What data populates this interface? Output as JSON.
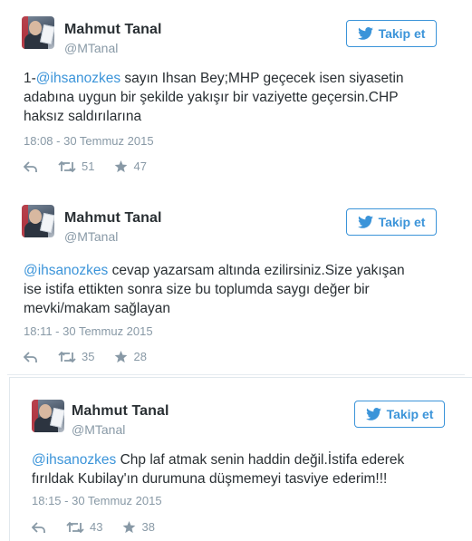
{
  "colors": {
    "accent": "#3b94d9",
    "text": "#292f33",
    "muted": "#8899a6"
  },
  "tweets": [
    {
      "name": "Mahmut Tanal",
      "handle": "@MTanal",
      "follow_label": "Takip et",
      "mention": "@ihsanozkes",
      "lines": [
        " sayın Ihsan Bey;MHP geçecek isen siyasetin",
        "adabına uygun bir şekilde yakışır bir vaziyette geçersin.CHP",
        "haksız saldırılarına"
      ],
      "prefix": "1-",
      "timestamp": "18:08 - 30 Temmuz 2015",
      "retweets": "51",
      "likes": "47"
    },
    {
      "name": "Mahmut Tanal",
      "handle": "@MTanal",
      "follow_label": "Takip et",
      "mention": "@ihsanozkes",
      "lines": [
        " cevap yazarsam altında ezilirsiniz.Size yakışan",
        "ise istifa ettikten sonra size bu toplumda saygı değer bir",
        "mevki/makam sağlayan"
      ],
      "prefix": "",
      "timestamp": "18:11 - 30 Temmuz 2015",
      "retweets": "35",
      "likes": "28"
    },
    {
      "name": "Mahmut Tanal",
      "handle": "@MTanal",
      "follow_label": "Takip et",
      "mention": "@ihsanozkes",
      "lines": [
        " Chp laf atmak senin haddin değil.İstifa ederek",
        "fırıldak Kubilay'ın durumuna düşmemeyi tasviye ederim!!!"
      ],
      "prefix": "",
      "timestamp": "18:15 - 30 Temmuz 2015",
      "retweets": "43",
      "likes": "38"
    }
  ]
}
